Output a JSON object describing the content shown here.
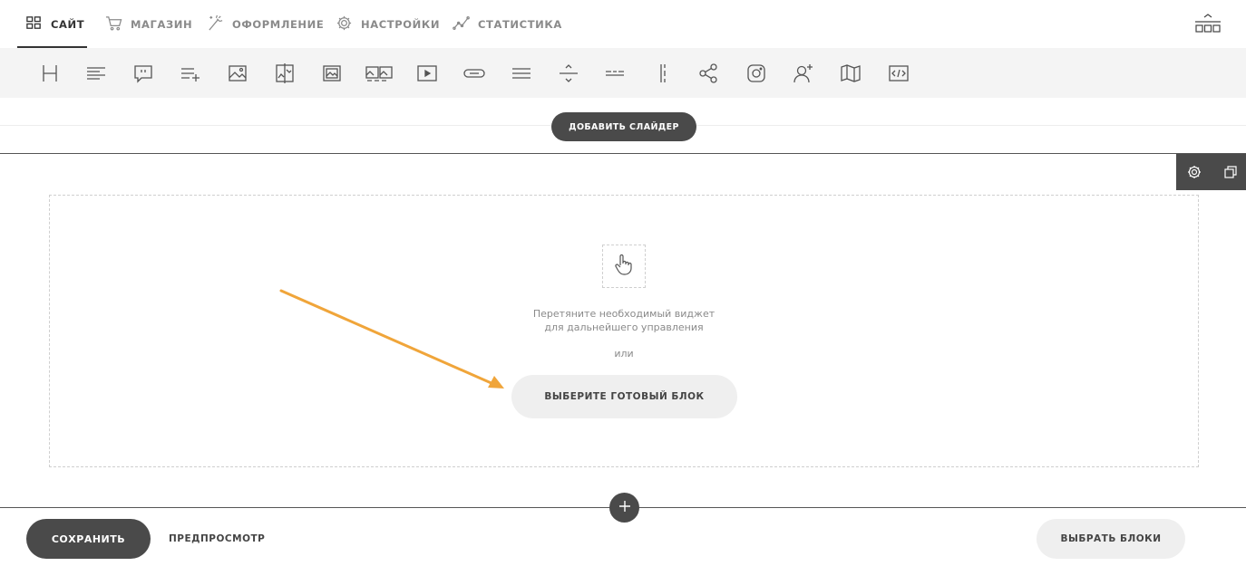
{
  "nav": {
    "items": [
      {
        "label": "САЙТ",
        "icon": "grid-icon",
        "active": true
      },
      {
        "label": "МАГАЗИН",
        "icon": "cart-icon",
        "active": false
      },
      {
        "label": "ОФОРМЛЕНИЕ",
        "icon": "magic-wand-icon",
        "active": false
      },
      {
        "label": "НАСТРОЙКИ",
        "icon": "gear-icon",
        "active": false
      },
      {
        "label": "СТАТИСТИКА",
        "icon": "line-chart-icon",
        "active": false
      }
    ],
    "right_icon": "site-structure-icon"
  },
  "toolbar": {
    "tools": [
      "heading-icon",
      "text-icon",
      "quote-icon",
      "list-add-icon",
      "image-icon",
      "image-compare-icon",
      "image-frame-icon",
      "gallery-icon",
      "video-icon",
      "button-icon",
      "lines-icon",
      "divider-icon",
      "dashed-line-icon",
      "columns-divider-icon",
      "share-icon",
      "instagram-icon",
      "user-add-icon",
      "map-icon",
      "code-icon"
    ]
  },
  "slider": {
    "add_label": "ДОБАВИТЬ СЛАЙДЕР"
  },
  "block_controls": [
    "gear-icon",
    "copy-icon"
  ],
  "dropzone": {
    "hint_line1": "Перетяните необходимый виджет",
    "hint_line2": "для дальнейшего управления",
    "or": "или",
    "choose_label": "ВЫБЕРИТЕ ГОТОВЫЙ БЛОК"
  },
  "colors": {
    "dark": "#4a4a4a",
    "light_button": "#efefef",
    "toolbar_bg": "#f4f4f4",
    "arrow": "#f0a53a"
  },
  "footer": {
    "save_label": "СОХРАНИТЬ",
    "preview_label": "ПРЕДПРОСМОТР",
    "select_blocks_label": "ВЫБРАТЬ БЛОКИ"
  }
}
